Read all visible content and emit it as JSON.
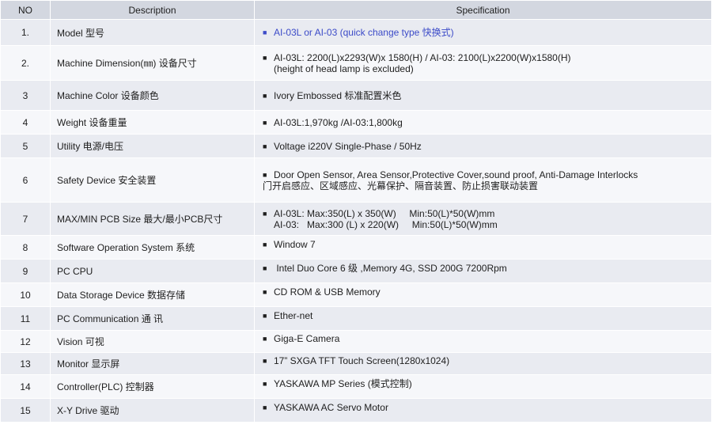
{
  "header": {
    "no": "NO",
    "description": "Description",
    "specification": "Specification"
  },
  "bullet_icon": "■",
  "accent_color": "#3c4bc8",
  "rows": [
    {
      "no": "1.",
      "description": "Model 型号",
      "spec": [
        "AI-03L or AI-03  (quick change type 快换式)"
      ]
    },
    {
      "no": "2.",
      "description": "Machine Dimension(㎜) 设备尺寸",
      "spec": [
        "AI-03L: 2200(L)x2293(W)x 1580(H) / AI-03: 2100(L)x2200(W)x1580(H)",
        "(height of head lamp is excluded)"
      ]
    },
    {
      "no": "3",
      "description": "Machine Color 设备颜色",
      "spec": [
        "Ivory Embossed 标准配置米色"
      ]
    },
    {
      "no": "4",
      "description": "Weight 设备重量",
      "spec": [
        "AI-03L:1,970kg /AI-03:1,800kg"
      ]
    },
    {
      "no": "5",
      "description": "Utility 电源/电压",
      "spec": [
        "Voltage i220V Single-Phase / 50Hz"
      ]
    },
    {
      "no": "6",
      "description": "Safety Device 安全装置",
      "spec": [
        "Door Open Sensor, Area Sensor,Protective Cover,sound proof, Anti-Damage Interlocks",
        "门开启感应、区域感应、光幕保护、隔音装置、防止损害联动装置"
      ]
    },
    {
      "no": "7",
      "description": "MAX/MIN PCB Size 最大/最小PCB尺寸",
      "spec": [
        "AI-03L: Max:350(L) x 350(W)     Min:50(L)*50(W)mm",
        "AI-03:   Max:300 (L) x 220(W)     Min:50(L)*50(W)mm"
      ]
    },
    {
      "no": "8",
      "description": "Software Operation System 系统",
      "spec": [
        "Window 7"
      ]
    },
    {
      "no": "9",
      "description": "PC CPU",
      "spec": [
        " Intel Duo Core 6 级 ,Memory 4G, SSD 200G 7200Rpm"
      ]
    },
    {
      "no": "10",
      "description": "Data Storage Device 数据存储",
      "spec": [
        "CD ROM & USB Memory"
      ]
    },
    {
      "no": "11",
      "description": "PC Communication 通 讯",
      "spec": [
        "Ether-net"
      ]
    },
    {
      "no": "12",
      "description": "Vision 可视",
      "spec": [
        "Giga-E Camera"
      ]
    },
    {
      "no": "13",
      "description": "Monitor 显示屏",
      "spec": [
        "17” SXGA TFT Touch Screen(1280x1024)"
      ]
    },
    {
      "no": "14",
      "description": "Controller(PLC) 控制器",
      "spec": [
        "YASKAWA MP Series (模式控制)"
      ]
    },
    {
      "no": "15",
      "description": "X-Y Drive 驱动",
      "spec": [
        "YASKAWA AC Servo Motor"
      ]
    }
  ]
}
